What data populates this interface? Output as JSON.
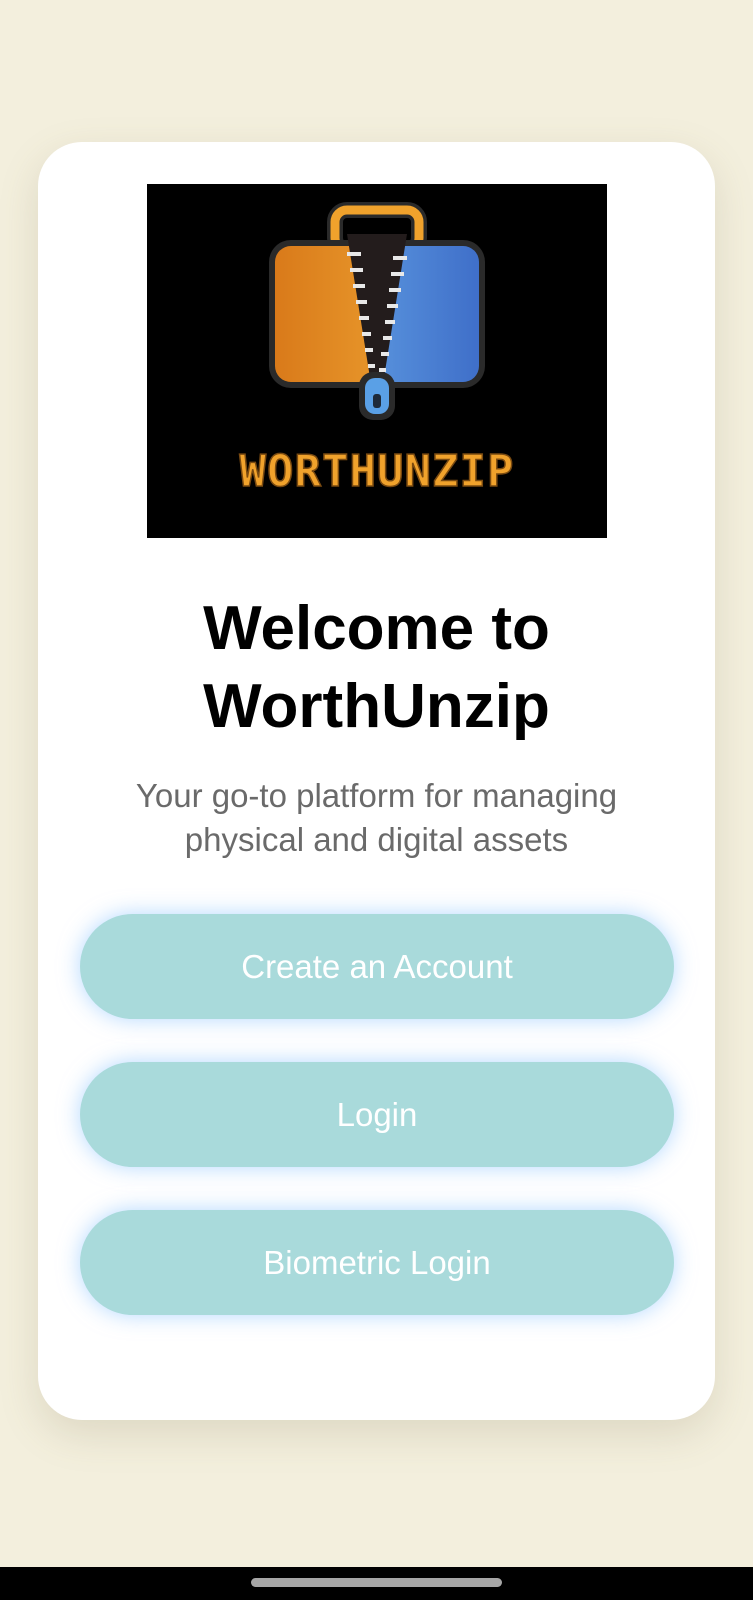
{
  "logo": {
    "icon": "zipped-suitcase-icon",
    "wordmark": "WORTHUNZIP",
    "colors": {
      "background": "#000000",
      "left_panel": "#f0a22c",
      "right_panel": "#4a8ee0",
      "handle": "#f0a22c",
      "wordmark": "#f0a22c"
    }
  },
  "welcome": {
    "title_line1": "Welcome to",
    "title_line2": "WorthUnzip",
    "subtitle": "Your go-to platform for managing physical and digital assets"
  },
  "actions": {
    "create_account": "Create an Account",
    "login": "Login",
    "biometric_login": "Biometric Login"
  },
  "colors": {
    "page_background": "#f3efdd",
    "card_background": "#ffffff",
    "button_fill": "#a9dadb",
    "button_text": "#ffffff",
    "subtitle_text": "#6a6a6a"
  }
}
